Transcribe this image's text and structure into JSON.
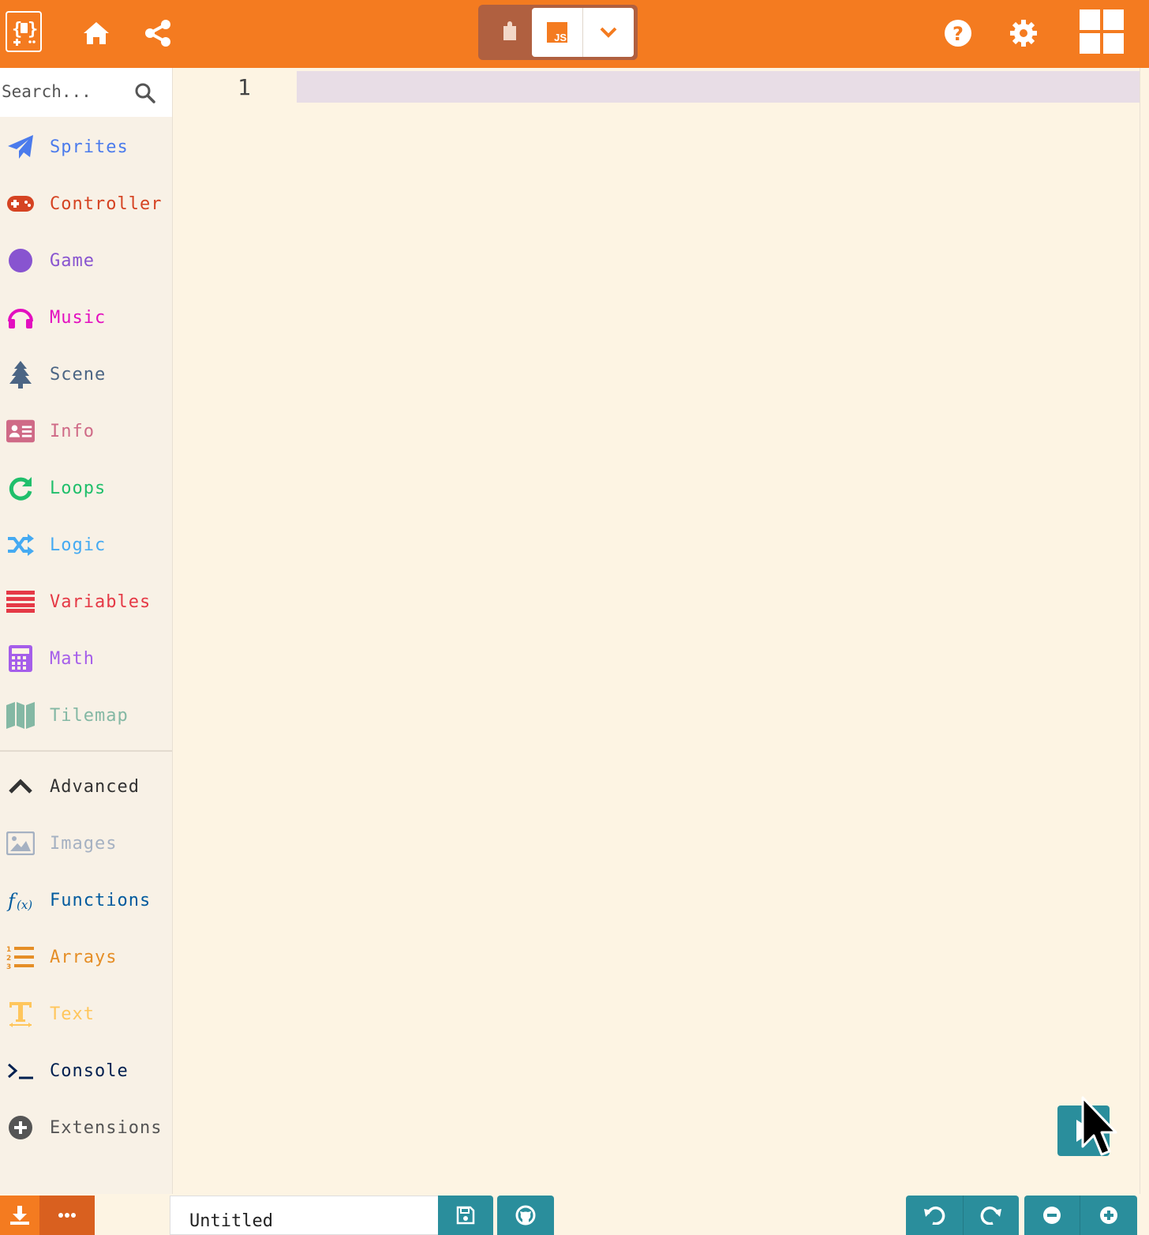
{
  "header": {
    "logo_icon": "microbit-arcade-logo-icon",
    "home_icon": "home-icon",
    "share_icon": "share-icon",
    "editor_toggle": {
      "blocks_icon": "puzzle-icon",
      "js_label": "JS",
      "dropdown_icon": "chevron-down-icon"
    },
    "help_icon": "help-icon",
    "settings_icon": "gear-icon",
    "menu_icon": "grid-icon"
  },
  "search": {
    "placeholder": "Search..."
  },
  "categories": [
    {
      "label": "Sprites",
      "icon": "paper-plane-icon",
      "color": "#4b7bec"
    },
    {
      "label": "Controller",
      "icon": "gamepad-icon",
      "color": "#d54322"
    },
    {
      "label": "Game",
      "icon": "circle-icon",
      "color": "#8854d0"
    },
    {
      "label": "Music",
      "icon": "headphones-icon",
      "color": "#e30fc0"
    },
    {
      "label": "Scene",
      "icon": "tree-icon",
      "color": "#4b6584"
    },
    {
      "label": "Info",
      "icon": "id-card-icon",
      "color": "#cf6a87"
    },
    {
      "label": "Loops",
      "icon": "refresh-icon",
      "color": "#20bf6b"
    },
    {
      "label": "Logic",
      "icon": "shuffle-icon",
      "color": "#45aaf2"
    },
    {
      "label": "Variables",
      "icon": "list-icon",
      "color": "#e53946"
    },
    {
      "label": "Math",
      "icon": "calculator-icon",
      "color": "#a55eea"
    },
    {
      "label": "Tilemap",
      "icon": "map-icon",
      "color": "#84b8a4"
    }
  ],
  "advanced": [
    {
      "label": "Advanced",
      "icon": "chevron-up-icon",
      "color": "#333333"
    },
    {
      "label": "Images",
      "icon": "image-icon",
      "color": "#a5b1c2"
    },
    {
      "label": "Functions",
      "icon": "function-icon",
      "color": "#005a9e"
    },
    {
      "label": "Arrays",
      "icon": "ordered-list-icon",
      "color": "#e58e26"
    },
    {
      "label": "Text",
      "icon": "text-icon",
      "color": "#ffc65c"
    },
    {
      "label": "Console",
      "icon": "terminal-icon",
      "color": "#002050"
    },
    {
      "label": "Extensions",
      "icon": "plus-circle-icon",
      "color": "#555555"
    }
  ],
  "editor": {
    "line_number": "1"
  },
  "footer": {
    "project_name": "Untitled",
    "download_icon": "download-icon",
    "more_icon": "ellipsis-icon",
    "save_icon": "floppy-disk-icon",
    "github_icon": "github-icon",
    "undo_icon": "undo-icon",
    "redo_icon": "redo-icon",
    "zoom_out_icon": "zoom-out-icon",
    "zoom_in_icon": "zoom-in-icon"
  },
  "colors": {
    "accent": "#f47b20",
    "accent_dark": "#d9601f",
    "teal": "#2a8e9c",
    "editor_bg": "#fdf4e3"
  }
}
